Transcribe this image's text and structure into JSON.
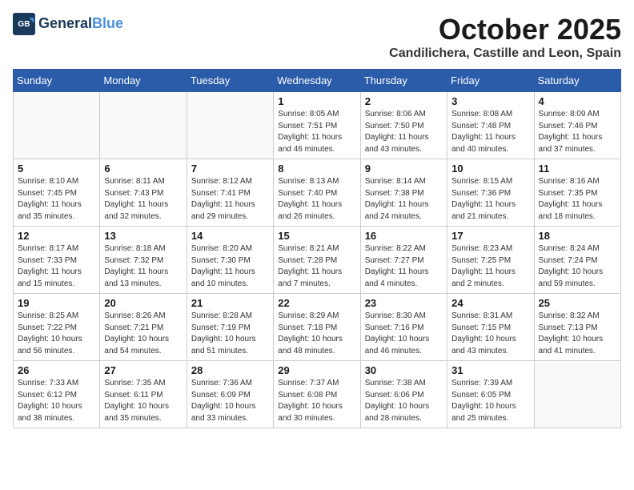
{
  "logo": {
    "line1": "General",
    "line2": "Blue"
  },
  "title": "October 2025",
  "location": "Candilichera, Castille and Leon, Spain",
  "weekdays": [
    "Sunday",
    "Monday",
    "Tuesday",
    "Wednesday",
    "Thursday",
    "Friday",
    "Saturday"
  ],
  "weeks": [
    [
      {
        "day": "",
        "info": ""
      },
      {
        "day": "",
        "info": ""
      },
      {
        "day": "",
        "info": ""
      },
      {
        "day": "1",
        "info": "Sunrise: 8:05 AM\nSunset: 7:51 PM\nDaylight: 11 hours\nand 46 minutes."
      },
      {
        "day": "2",
        "info": "Sunrise: 8:06 AM\nSunset: 7:50 PM\nDaylight: 11 hours\nand 43 minutes."
      },
      {
        "day": "3",
        "info": "Sunrise: 8:08 AM\nSunset: 7:48 PM\nDaylight: 11 hours\nand 40 minutes."
      },
      {
        "day": "4",
        "info": "Sunrise: 8:09 AM\nSunset: 7:46 PM\nDaylight: 11 hours\nand 37 minutes."
      }
    ],
    [
      {
        "day": "5",
        "info": "Sunrise: 8:10 AM\nSunset: 7:45 PM\nDaylight: 11 hours\nand 35 minutes."
      },
      {
        "day": "6",
        "info": "Sunrise: 8:11 AM\nSunset: 7:43 PM\nDaylight: 11 hours\nand 32 minutes."
      },
      {
        "day": "7",
        "info": "Sunrise: 8:12 AM\nSunset: 7:41 PM\nDaylight: 11 hours\nand 29 minutes."
      },
      {
        "day": "8",
        "info": "Sunrise: 8:13 AM\nSunset: 7:40 PM\nDaylight: 11 hours\nand 26 minutes."
      },
      {
        "day": "9",
        "info": "Sunrise: 8:14 AM\nSunset: 7:38 PM\nDaylight: 11 hours\nand 24 minutes."
      },
      {
        "day": "10",
        "info": "Sunrise: 8:15 AM\nSunset: 7:36 PM\nDaylight: 11 hours\nand 21 minutes."
      },
      {
        "day": "11",
        "info": "Sunrise: 8:16 AM\nSunset: 7:35 PM\nDaylight: 11 hours\nand 18 minutes."
      }
    ],
    [
      {
        "day": "12",
        "info": "Sunrise: 8:17 AM\nSunset: 7:33 PM\nDaylight: 11 hours\nand 15 minutes."
      },
      {
        "day": "13",
        "info": "Sunrise: 8:18 AM\nSunset: 7:32 PM\nDaylight: 11 hours\nand 13 minutes."
      },
      {
        "day": "14",
        "info": "Sunrise: 8:20 AM\nSunset: 7:30 PM\nDaylight: 11 hours\nand 10 minutes."
      },
      {
        "day": "15",
        "info": "Sunrise: 8:21 AM\nSunset: 7:28 PM\nDaylight: 11 hours\nand 7 minutes."
      },
      {
        "day": "16",
        "info": "Sunrise: 8:22 AM\nSunset: 7:27 PM\nDaylight: 11 hours\nand 4 minutes."
      },
      {
        "day": "17",
        "info": "Sunrise: 8:23 AM\nSunset: 7:25 PM\nDaylight: 11 hours\nand 2 minutes."
      },
      {
        "day": "18",
        "info": "Sunrise: 8:24 AM\nSunset: 7:24 PM\nDaylight: 10 hours\nand 59 minutes."
      }
    ],
    [
      {
        "day": "19",
        "info": "Sunrise: 8:25 AM\nSunset: 7:22 PM\nDaylight: 10 hours\nand 56 minutes."
      },
      {
        "day": "20",
        "info": "Sunrise: 8:26 AM\nSunset: 7:21 PM\nDaylight: 10 hours\nand 54 minutes."
      },
      {
        "day": "21",
        "info": "Sunrise: 8:28 AM\nSunset: 7:19 PM\nDaylight: 10 hours\nand 51 minutes."
      },
      {
        "day": "22",
        "info": "Sunrise: 8:29 AM\nSunset: 7:18 PM\nDaylight: 10 hours\nand 48 minutes."
      },
      {
        "day": "23",
        "info": "Sunrise: 8:30 AM\nSunset: 7:16 PM\nDaylight: 10 hours\nand 46 minutes."
      },
      {
        "day": "24",
        "info": "Sunrise: 8:31 AM\nSunset: 7:15 PM\nDaylight: 10 hours\nand 43 minutes."
      },
      {
        "day": "25",
        "info": "Sunrise: 8:32 AM\nSunset: 7:13 PM\nDaylight: 10 hours\nand 41 minutes."
      }
    ],
    [
      {
        "day": "26",
        "info": "Sunrise: 7:33 AM\nSunset: 6:12 PM\nDaylight: 10 hours\nand 38 minutes."
      },
      {
        "day": "27",
        "info": "Sunrise: 7:35 AM\nSunset: 6:11 PM\nDaylight: 10 hours\nand 35 minutes."
      },
      {
        "day": "28",
        "info": "Sunrise: 7:36 AM\nSunset: 6:09 PM\nDaylight: 10 hours\nand 33 minutes."
      },
      {
        "day": "29",
        "info": "Sunrise: 7:37 AM\nSunset: 6:08 PM\nDaylight: 10 hours\nand 30 minutes."
      },
      {
        "day": "30",
        "info": "Sunrise: 7:38 AM\nSunset: 6:06 PM\nDaylight: 10 hours\nand 28 minutes."
      },
      {
        "day": "31",
        "info": "Sunrise: 7:39 AM\nSunset: 6:05 PM\nDaylight: 10 hours\nand 25 minutes."
      },
      {
        "day": "",
        "info": ""
      }
    ]
  ]
}
